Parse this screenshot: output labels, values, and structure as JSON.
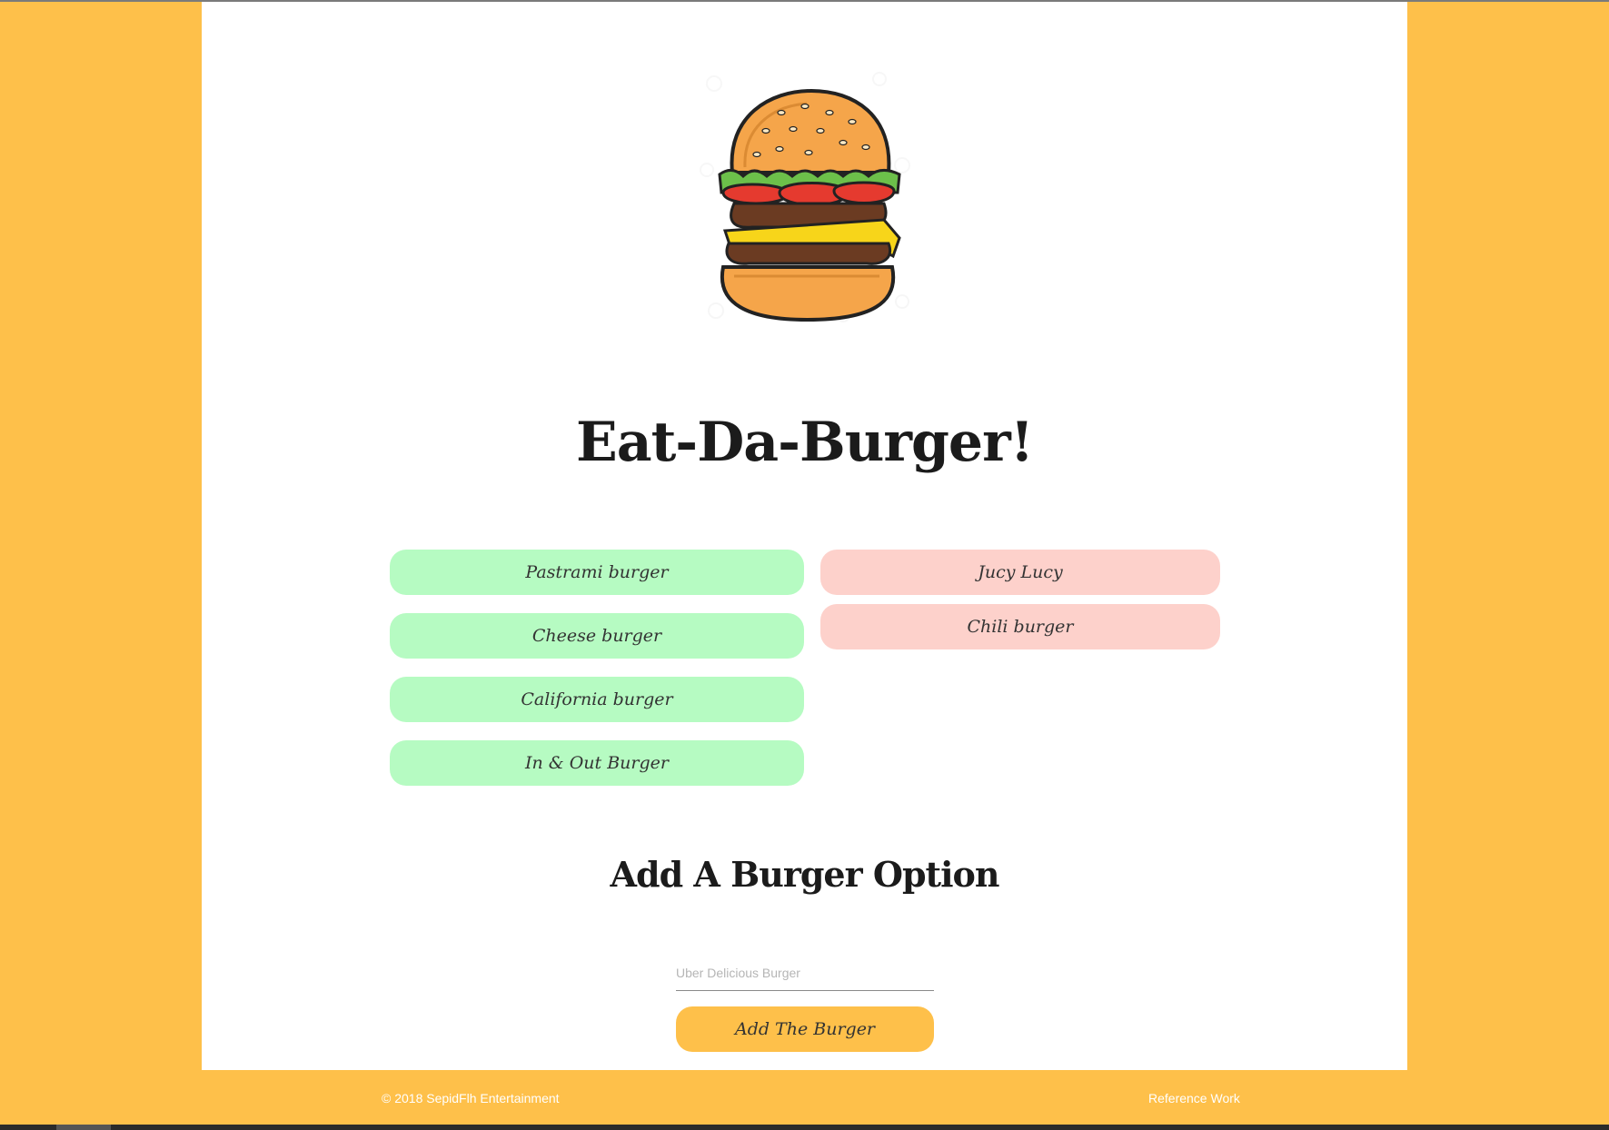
{
  "page": {
    "title": "Eat-Da-Burger!",
    "add_heading": "Add A Burger Option"
  },
  "colors": {
    "background": "#FEC04A",
    "card": "#FFFFFF",
    "uneaten": "#B6FBC2",
    "devoured": "#FDD1CB",
    "button": "#FEC04A"
  },
  "logo": {
    "icon": "burger-icon"
  },
  "uneaten_burgers": [
    {
      "name": "Pastrami burger"
    },
    {
      "name": "Cheese burger"
    },
    {
      "name": "California burger"
    },
    {
      "name": "In & Out Burger"
    }
  ],
  "devoured_burgers": [
    {
      "name": "Jucy Lucy"
    },
    {
      "name": "Chili burger"
    }
  ],
  "form": {
    "input_value": "",
    "placeholder": "Uber Delicious Burger",
    "submit_label": "Add The Burger"
  },
  "footer": {
    "copyright": "© 2018 SepidFlh Entertainment",
    "link": "Reference Work"
  }
}
